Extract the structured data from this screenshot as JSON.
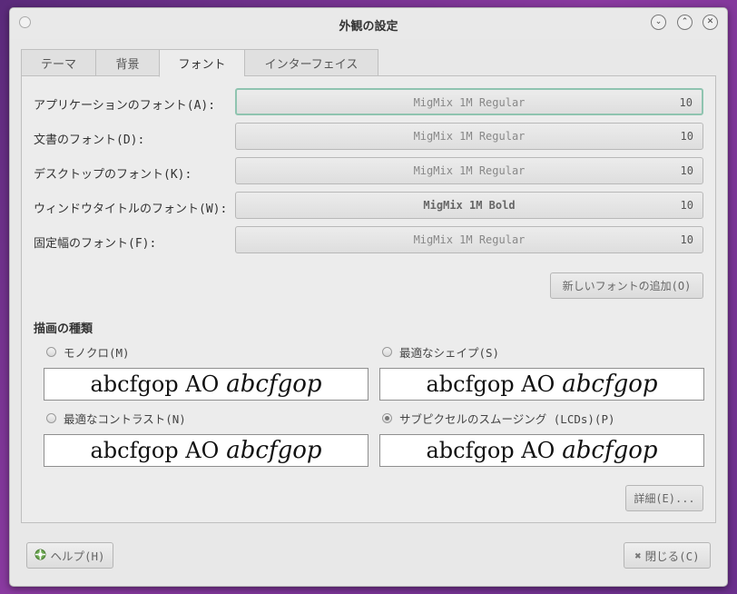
{
  "window": {
    "title": "外観の設定"
  },
  "tabs": [
    {
      "label": "テーマ"
    },
    {
      "label": "背景"
    },
    {
      "label": "フォント"
    },
    {
      "label": "インターフェイス"
    }
  ],
  "fonts": [
    {
      "label": "アプリケーションのフォント(A):",
      "font": "MigMix 1M Regular",
      "size": "10"
    },
    {
      "label": "文書のフォント(D):",
      "font": "MigMix 1M Regular",
      "size": "10"
    },
    {
      "label": "デスクトップのフォント(K):",
      "font": "MigMix 1M Regular",
      "size": "10"
    },
    {
      "label": "ウィンドウタイトルのフォント(W):",
      "font": "MigMix 1M Bold",
      "size": "10"
    },
    {
      "label": "固定幅のフォント(F):",
      "font": "MigMix 1M Regular",
      "size": "10"
    }
  ],
  "add_font_label": "新しいフォントの追加(O)",
  "rendering": {
    "title": "描画の種類",
    "options": [
      {
        "label": "モノクロ(M)",
        "preview_plain": "abcfgop AO",
        "preview_italic": "abcfgop"
      },
      {
        "label": "最適なシェイプ(S)",
        "preview_plain": "abcfgop AO",
        "preview_italic": "abcfgop"
      },
      {
        "label": "最適なコントラスト(N)",
        "preview_plain": "abcfgop AO",
        "preview_italic": "abcfgop"
      },
      {
        "label": "サブピクセルのスムージング (LCDs)(P)",
        "preview_plain": "abcfgop AO",
        "preview_italic": "abcfgop"
      }
    ],
    "selected": "サブピクセルのスムージング (LCDs)(P)"
  },
  "details_label": "詳細(E)...",
  "help_label": "ヘルプ(H)",
  "close_label": "閉じる(C)",
  "icons": {
    "help": "lifebuoy-icon",
    "close": "x-icon"
  }
}
